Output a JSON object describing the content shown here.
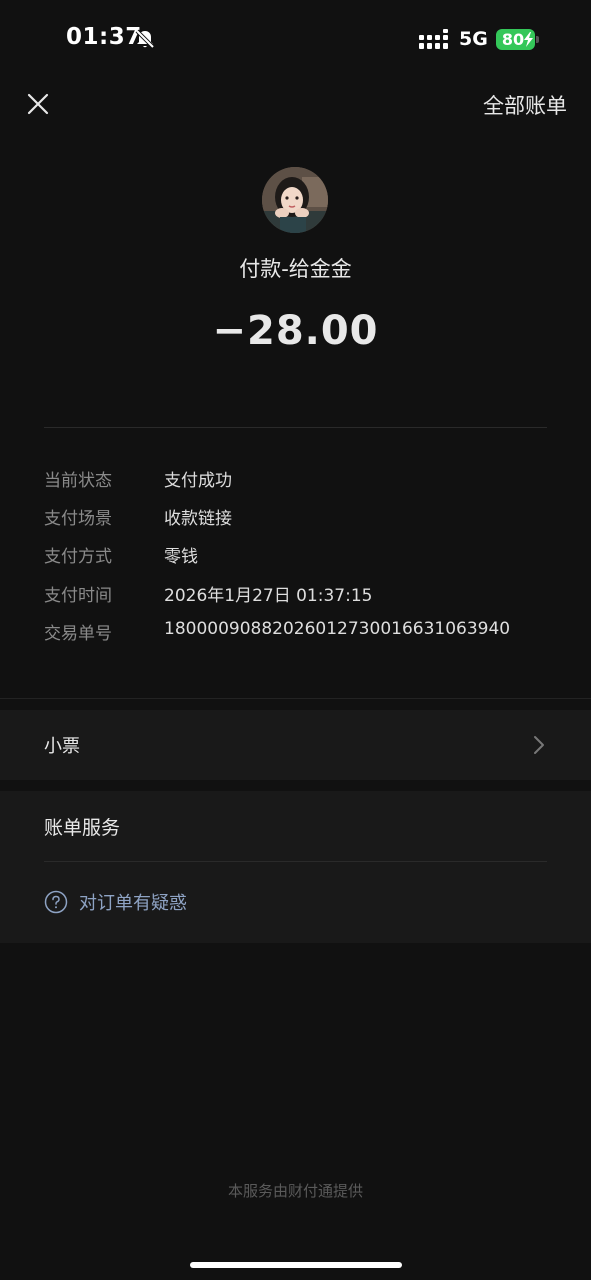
{
  "status_bar": {
    "time": "01:37",
    "network": "5G",
    "battery": "80",
    "battery_color": "#34c759"
  },
  "nav": {
    "close_icon": "close-icon",
    "all_bills": "全部账单"
  },
  "header": {
    "payee": "付款-给金金",
    "amount": "−28.00"
  },
  "details": [
    {
      "label": "当前状态",
      "value": "支付成功"
    },
    {
      "label": "支付场景",
      "value": "收款链接"
    },
    {
      "label": "支付方式",
      "value": "零钱"
    },
    {
      "label": "支付时间",
      "value": "2026年1月27日 01:37:15"
    },
    {
      "label": "交易单号",
      "value": "1800009088202601273001663106394​0"
    }
  ],
  "receipt": {
    "label": "小票"
  },
  "service": {
    "title": "账单服务",
    "dispute": "对订单有疑惑"
  },
  "footer": "本服务由财付通提供"
}
